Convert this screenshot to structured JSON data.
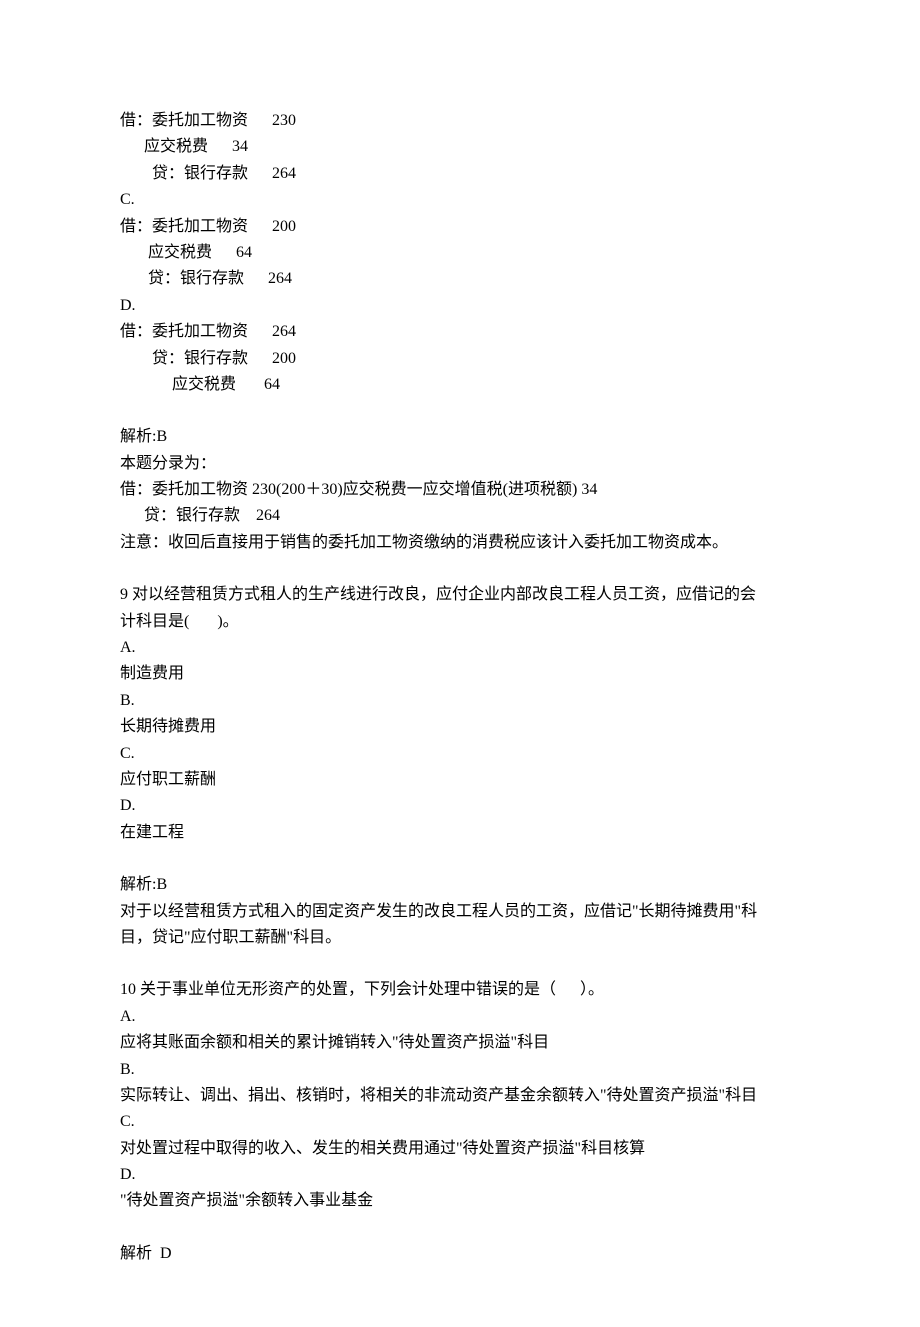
{
  "entry_pre": {
    "lines": [
      "借：委托加工物资      230",
      "      应交税费      34",
      "        贷：银行存款      264",
      "C.",
      "借：委托加工物资      200",
      "       应交税费      64",
      "       贷：银行存款      264",
      "D.",
      "借：委托加工物资      264",
      "        贷：银行存款      200",
      "             应交税费       64"
    ]
  },
  "analysis8": {
    "lines": [
      "解析:B",
      "本题分录为：",
      "借：委托加工物资 230(200＋30)应交税费一应交增值税(进项税额) 34",
      "      贷：银行存款    264",
      "注意：收回后直接用于销售的委托加工物资缴纳的消费税应该计入委托加工物资成本。"
    ]
  },
  "q9": {
    "stem1": "9 对以经营租赁方式租人的生产线进行改良，应付企业内部改良工程人员工资，应借记的会",
    "stem2": "计科目是(       )。",
    "opts": [
      "A.",
      "制造费用",
      "B.",
      "长期待摊费用",
      "C.",
      "应付职工薪酬",
      "D.",
      "在建工程"
    ],
    "analysis": [
      "解析:B",
      "对于以经营租赁方式租入的固定资产发生的改良工程人员的工资，应借记\"长期待摊费用\"科",
      "目，贷记\"应付职工薪酬\"科目。"
    ]
  },
  "q10": {
    "stem": "10 关于事业单位无形资产的处置，下列会计处理中错误的是（      ）。",
    "opts": [
      "A.",
      "应将其账面余额和相关的累计摊销转入\"待处置资产损溢\"科目",
      "B.",
      "实际转让、调出、捐出、核销时，将相关的非流动资产基金余额转入\"待处置资产损溢\"科目",
      "C.",
      "对处置过程中取得的收入、发生的相关费用通过\"待处置资产损溢\"科目核算",
      "D.",
      "\"待处置资产损溢\"余额转入事业基金"
    ],
    "analysis": [
      "解析  D"
    ]
  }
}
